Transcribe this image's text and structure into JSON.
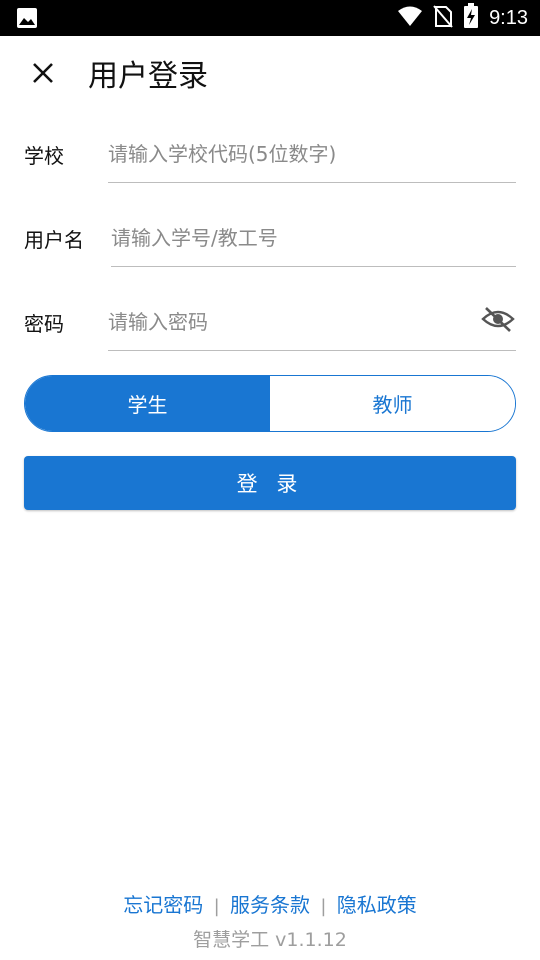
{
  "status_bar": {
    "time": "9:13",
    "icons": [
      "image-icon",
      "wifi-icon",
      "no-sim-icon",
      "battery-charging-icon"
    ]
  },
  "header": {
    "title": "用户登录",
    "close_icon": "close-icon"
  },
  "form": {
    "school": {
      "label": "学校",
      "placeholder": "请输入学校代码(5位数字)",
      "value": ""
    },
    "username": {
      "label": "用户名",
      "placeholder": "请输入学号/教工号",
      "value": ""
    },
    "password": {
      "label": "密码",
      "placeholder": "请输入密码",
      "value": "",
      "toggle_icon": "eye-off-icon"
    }
  },
  "role_toggle": {
    "options": [
      "学生",
      "教师"
    ],
    "selected": "学生"
  },
  "login_button": {
    "label": "登 录"
  },
  "footer": {
    "forgot_password": "忘记密码",
    "terms": "服务条款",
    "privacy": "隐私政策",
    "separator": "|",
    "version": "智慧学工 v1.1.12"
  },
  "colors": {
    "accent": "#1976d2",
    "status_bar": "#000000",
    "muted": "#9e9e9e"
  }
}
